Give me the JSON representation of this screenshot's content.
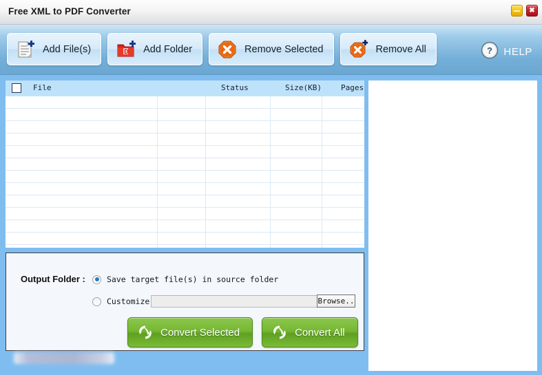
{
  "window": {
    "title": "Free XML to PDF Converter",
    "controls": [
      {
        "name": "minimize",
        "glyph": "–"
      },
      {
        "name": "close",
        "glyph": "✖"
      }
    ],
    "colors": {
      "titlebar_bg": "#f4f4f4",
      "toolbar_top": "#cfe6f7",
      "toolbar_bottom": "#6ba7d2",
      "frame_blue": "#7fbdf0",
      "list_header_bg": "#bfe2fb",
      "convert_green": "#76b832",
      "remove_orange": "#e86a17",
      "folder_red": "#d8201d"
    }
  },
  "toolbar": {
    "buttons": [
      {
        "label": "Add File(s)",
        "icon": "document-plus-icon"
      },
      {
        "label": "Add Folder",
        "icon": "folder-plus-icon"
      },
      {
        "label": "Remove Selected",
        "icon": "remove-x-icon"
      },
      {
        "label": "Remove All",
        "icon": "remove-x-plus-icon"
      }
    ],
    "help": {
      "label": "HELP",
      "icon": "question-circle-icon"
    }
  },
  "file_list": {
    "select_all_checked": false,
    "columns": [
      "File",
      "Status",
      "Size(KB)",
      "Pages"
    ],
    "rows": [],
    "empty_row_count": 12
  },
  "preview": {
    "content": ""
  },
  "output": {
    "label": "Output Folder :",
    "options": [
      {
        "label": "Save target file(s) in source folder",
        "selected": true
      },
      {
        "label": "Customize",
        "selected": false
      }
    ],
    "path_value": "",
    "path_placeholder": "",
    "browse_label": "Browse..",
    "convert_buttons": [
      {
        "label": "Convert Selected",
        "icon": "convert-arrows-icon"
      },
      {
        "label": "Convert All",
        "icon": "convert-arrows-icon"
      }
    ]
  },
  "footer": {
    "blurred_item": ""
  }
}
